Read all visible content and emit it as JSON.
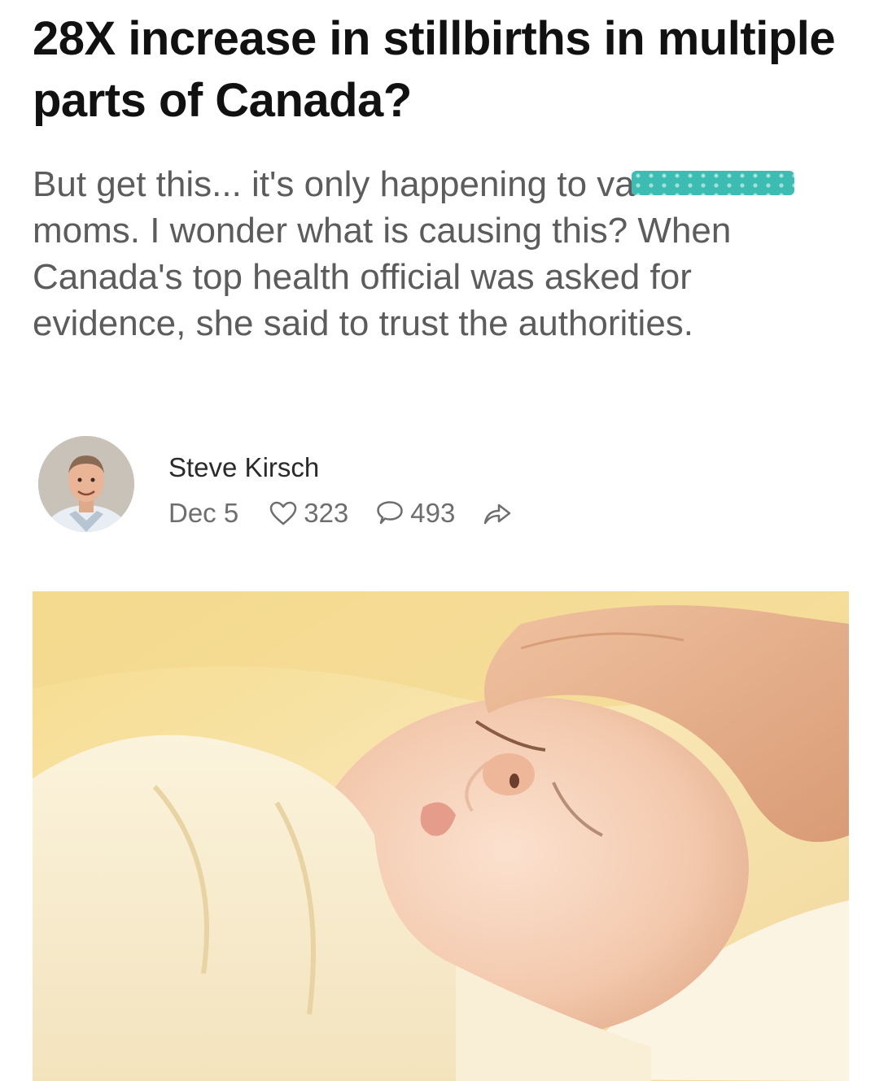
{
  "post": {
    "title": "28X increase in stillbirths in multiple parts of Canada?",
    "subtitle_before_redaction": "But get this... it's only happening to va",
    "subtitle_after_redaction": " moms. I wonder what is causing this? When Canada's top health official was asked for evidence, she said to trust the authorities.",
    "author": {
      "name": "Steve Kirsch",
      "avatar_icon": "author-avatar-photo"
    },
    "meta": {
      "date": "Dec 5",
      "likes": "323",
      "comments": "493",
      "like_icon": "heart-icon",
      "comment_icon": "speech-bubble-icon",
      "share_icon": "share-arrow-icon"
    },
    "hero_image": "sleeping-newborn-photo"
  },
  "colors": {
    "title": "#111111",
    "subtitle": "#5c5c5c",
    "meta": "#6e6e6e",
    "redaction": "#3dbdb2"
  }
}
